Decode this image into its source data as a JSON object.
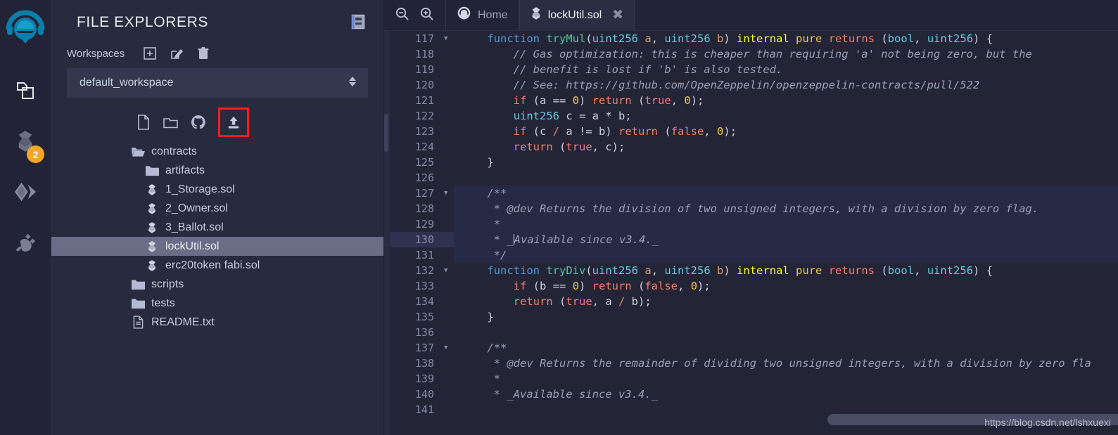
{
  "rail": {
    "logo_name": "remix-logo",
    "items": [
      {
        "name": "file-explorers",
        "icon": "files-icon",
        "badge": ""
      },
      {
        "name": "solidity-compiler",
        "icon": "solidity-icon",
        "badge": "2"
      },
      {
        "name": "deploy-run-transactions",
        "icon": "ethereum-deploy-icon",
        "badge": ""
      },
      {
        "name": "plugin-manager",
        "icon": "plug-icon",
        "badge": ""
      }
    ]
  },
  "explorer": {
    "title": "FILE EXPLORERS",
    "header_icon": "documentation-book-icon",
    "workspaces_label": "Workspaces",
    "workspace_actions": [
      {
        "name": "create-workspace",
        "icon": "plus-square-icon"
      },
      {
        "name": "rename-workspace",
        "icon": "pencil-square-icon"
      },
      {
        "name": "delete-workspace",
        "icon": "trash-icon"
      }
    ],
    "selected_workspace": "default_workspace",
    "file_actions": [
      {
        "name": "new-file",
        "icon": "file-icon"
      },
      {
        "name": "new-folder",
        "icon": "folder-icon"
      },
      {
        "name": "connect-github",
        "icon": "github-icon"
      },
      {
        "name": "publish-upload",
        "icon": "upload-icon",
        "highlighted": true
      }
    ],
    "tree": [
      {
        "label": "contracts",
        "type": "folder-open",
        "depth": 1,
        "selected": false
      },
      {
        "label": "artifacts",
        "type": "folder",
        "depth": 2,
        "selected": false
      },
      {
        "label": "1_Storage.sol",
        "type": "solidity",
        "depth": 2,
        "selected": false
      },
      {
        "label": "2_Owner.sol",
        "type": "solidity",
        "depth": 2,
        "selected": false
      },
      {
        "label": "3_Ballot.sol",
        "type": "solidity",
        "depth": 2,
        "selected": false
      },
      {
        "label": "lockUtil.sol",
        "type": "solidity",
        "depth": 2,
        "selected": true
      },
      {
        "label": "erc20token fabi.sol",
        "type": "solidity",
        "depth": 2,
        "selected": false
      },
      {
        "label": "scripts",
        "type": "folder",
        "depth": 1,
        "selected": false
      },
      {
        "label": "tests",
        "type": "folder",
        "depth": 1,
        "selected": false
      },
      {
        "label": "README.txt",
        "type": "file",
        "depth": 1,
        "selected": false
      }
    ]
  },
  "editor": {
    "zoom_out_label": "zoom-out",
    "zoom_in_label": "zoom-in",
    "home_tab": "Home",
    "active_tab": "lockUtil.sol",
    "close_glyph": "✖",
    "active_line": 130,
    "first_line": 117,
    "last_line": 141,
    "lines": [
      {
        "n": 117,
        "fold": true,
        "block": false,
        "tokens": [
          {
            "t": "    ",
            "c": "p"
          },
          {
            "t": "function ",
            "c": "k"
          },
          {
            "t": "tryMul",
            "c": "fn"
          },
          {
            "t": "(",
            "c": "p"
          },
          {
            "t": "uint256",
            "c": "ty"
          },
          {
            "t": " ",
            "c": "p"
          },
          {
            "t": "a",
            "c": "var"
          },
          {
            "t": ", ",
            "c": "p"
          },
          {
            "t": "uint256",
            "c": "ty"
          },
          {
            "t": " ",
            "c": "p"
          },
          {
            "t": "b",
            "c": "var"
          },
          {
            "t": ") ",
            "c": "p"
          },
          {
            "t": "internal",
            "c": "mod"
          },
          {
            "t": " ",
            "c": "p"
          },
          {
            "t": "pure",
            "c": "pu"
          },
          {
            "t": " ",
            "c": "p"
          },
          {
            "t": "returns",
            "c": "ctl"
          },
          {
            "t": " (",
            "c": "p"
          },
          {
            "t": "bool",
            "c": "ty"
          },
          {
            "t": ", ",
            "c": "p"
          },
          {
            "t": "uint256",
            "c": "ty"
          },
          {
            "t": ") {",
            "c": "p"
          }
        ]
      },
      {
        "n": 118,
        "fold": false,
        "block": false,
        "tokens": [
          {
            "t": "        // Gas optimization: this is cheaper than requiring 'a' not being zero, but the",
            "c": "cm"
          }
        ]
      },
      {
        "n": 119,
        "fold": false,
        "block": false,
        "tokens": [
          {
            "t": "        // benefit is lost if 'b' is also tested.",
            "c": "cm"
          }
        ]
      },
      {
        "n": 120,
        "fold": false,
        "block": false,
        "tokens": [
          {
            "t": "        // See: https://github.com/OpenZeppelin/openzeppelin-contracts/pull/522",
            "c": "cm"
          }
        ]
      },
      {
        "n": 121,
        "fold": false,
        "block": false,
        "tokens": [
          {
            "t": "        ",
            "c": "p"
          },
          {
            "t": "if",
            "c": "ctl"
          },
          {
            "t": " (",
            "c": "p"
          },
          {
            "t": "a",
            "c": "p"
          },
          {
            "t": " == ",
            "c": "p"
          },
          {
            "t": "0",
            "c": "num"
          },
          {
            "t": ") ",
            "c": "p"
          },
          {
            "t": "return",
            "c": "ctl"
          },
          {
            "t": " (",
            "c": "p"
          },
          {
            "t": "true",
            "c": "bl"
          },
          {
            "t": ", ",
            "c": "p"
          },
          {
            "t": "0",
            "c": "num"
          },
          {
            "t": ");",
            "c": "p"
          }
        ]
      },
      {
        "n": 122,
        "fold": false,
        "block": false,
        "tokens": [
          {
            "t": "        ",
            "c": "p"
          },
          {
            "t": "uint256",
            "c": "ty"
          },
          {
            "t": " c = a * b;",
            "c": "p"
          }
        ]
      },
      {
        "n": 123,
        "fold": false,
        "block": false,
        "tokens": [
          {
            "t": "        ",
            "c": "p"
          },
          {
            "t": "if",
            "c": "ctl"
          },
          {
            "t": " (c ",
            "c": "p"
          },
          {
            "t": "/",
            "c": "ctl"
          },
          {
            "t": " a != b) ",
            "c": "p"
          },
          {
            "t": "return",
            "c": "ctl"
          },
          {
            "t": " (",
            "c": "p"
          },
          {
            "t": "false",
            "c": "bl"
          },
          {
            "t": ", ",
            "c": "p"
          },
          {
            "t": "0",
            "c": "num"
          },
          {
            "t": ");",
            "c": "p"
          }
        ]
      },
      {
        "n": 124,
        "fold": false,
        "block": false,
        "tokens": [
          {
            "t": "        ",
            "c": "p"
          },
          {
            "t": "return",
            "c": "ctl"
          },
          {
            "t": " (",
            "c": "p"
          },
          {
            "t": "true",
            "c": "bl"
          },
          {
            "t": ", c);",
            "c": "p"
          }
        ]
      },
      {
        "n": 125,
        "fold": false,
        "block": false,
        "tokens": [
          {
            "t": "    }",
            "c": "p"
          }
        ]
      },
      {
        "n": 126,
        "fold": false,
        "block": false,
        "tokens": [
          {
            "t": "",
            "c": "p"
          }
        ]
      },
      {
        "n": 127,
        "fold": true,
        "block": true,
        "tokens": [
          {
            "t": "    /**",
            "c": "cm"
          }
        ]
      },
      {
        "n": 128,
        "fold": false,
        "block": true,
        "tokens": [
          {
            "t": "     * @dev Returns the division of two unsigned integers, with a division by zero flag.",
            "c": "cm"
          }
        ]
      },
      {
        "n": 129,
        "fold": false,
        "block": true,
        "tokens": [
          {
            "t": "     *",
            "c": "cm"
          }
        ]
      },
      {
        "n": 130,
        "fold": false,
        "block": true,
        "tokens": [
          {
            "t": "     * _Available since v3.4._",
            "c": "cm"
          }
        ]
      },
      {
        "n": 131,
        "fold": false,
        "block": true,
        "tokens": [
          {
            "t": "     */",
            "c": "cm"
          }
        ]
      },
      {
        "n": 132,
        "fold": true,
        "block": false,
        "tokens": [
          {
            "t": "    ",
            "c": "p"
          },
          {
            "t": "function ",
            "c": "k"
          },
          {
            "t": "tryDiv",
            "c": "fn"
          },
          {
            "t": "(",
            "c": "p"
          },
          {
            "t": "uint256",
            "c": "ty"
          },
          {
            "t": " ",
            "c": "p"
          },
          {
            "t": "a",
            "c": "var"
          },
          {
            "t": ", ",
            "c": "p"
          },
          {
            "t": "uint256",
            "c": "ty"
          },
          {
            "t": " ",
            "c": "p"
          },
          {
            "t": "b",
            "c": "var"
          },
          {
            "t": ") ",
            "c": "p"
          },
          {
            "t": "internal",
            "c": "mod"
          },
          {
            "t": " ",
            "c": "p"
          },
          {
            "t": "pure",
            "c": "pu"
          },
          {
            "t": " ",
            "c": "p"
          },
          {
            "t": "returns",
            "c": "ctl"
          },
          {
            "t": " (",
            "c": "p"
          },
          {
            "t": "bool",
            "c": "ty"
          },
          {
            "t": ", ",
            "c": "p"
          },
          {
            "t": "uint256",
            "c": "ty"
          },
          {
            "t": ") {",
            "c": "p"
          }
        ]
      },
      {
        "n": 133,
        "fold": false,
        "block": false,
        "tokens": [
          {
            "t": "        ",
            "c": "p"
          },
          {
            "t": "if",
            "c": "ctl"
          },
          {
            "t": " (b == ",
            "c": "p"
          },
          {
            "t": "0",
            "c": "num"
          },
          {
            "t": ") ",
            "c": "p"
          },
          {
            "t": "return",
            "c": "ctl"
          },
          {
            "t": " (",
            "c": "p"
          },
          {
            "t": "false",
            "c": "bl"
          },
          {
            "t": ", ",
            "c": "p"
          },
          {
            "t": "0",
            "c": "num"
          },
          {
            "t": ");",
            "c": "p"
          }
        ]
      },
      {
        "n": 134,
        "fold": false,
        "block": false,
        "tokens": [
          {
            "t": "        ",
            "c": "p"
          },
          {
            "t": "return",
            "c": "ctl"
          },
          {
            "t": " (",
            "c": "p"
          },
          {
            "t": "true",
            "c": "bl"
          },
          {
            "t": ", a ",
            "c": "p"
          },
          {
            "t": "/",
            "c": "ctl"
          },
          {
            "t": " b);",
            "c": "p"
          }
        ]
      },
      {
        "n": 135,
        "fold": false,
        "block": false,
        "tokens": [
          {
            "t": "    }",
            "c": "p"
          }
        ]
      },
      {
        "n": 136,
        "fold": false,
        "block": false,
        "tokens": [
          {
            "t": "",
            "c": "p"
          }
        ]
      },
      {
        "n": 137,
        "fold": true,
        "block": false,
        "tokens": [
          {
            "t": "    /**",
            "c": "cm"
          }
        ]
      },
      {
        "n": 138,
        "fold": false,
        "block": false,
        "tokens": [
          {
            "t": "     * @dev Returns the remainder of dividing two unsigned integers, with a division by zero fla",
            "c": "cm"
          }
        ]
      },
      {
        "n": 139,
        "fold": false,
        "block": false,
        "tokens": [
          {
            "t": "     *",
            "c": "cm"
          }
        ]
      },
      {
        "n": 140,
        "fold": false,
        "block": false,
        "tokens": [
          {
            "t": "     * _Available since v3.4._",
            "c": "cm"
          }
        ]
      },
      {
        "n": 141,
        "fold": false,
        "block": false,
        "tokens": [
          {
            "t": "",
            "c": "p"
          }
        ]
      }
    ]
  },
  "watermark": "https://blog.csdn.net/lshxuexi",
  "colors": {
    "app_bg": "#222336",
    "panel_bg": "#282a3e",
    "editor_bg": "#232436",
    "accent": "#007aa6",
    "badge": "#f5a623",
    "highlight_box": "#fd1d1d",
    "selection": "#6b6d86",
    "active_line": "#2e3150"
  }
}
